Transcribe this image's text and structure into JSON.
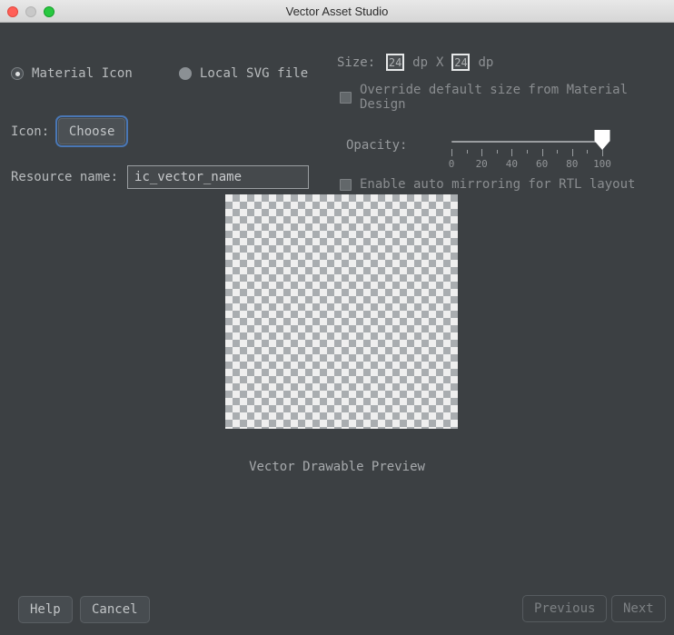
{
  "window": {
    "title": "Vector Asset Studio",
    "traffic_lights": [
      "close-button",
      "minimize-button",
      "zoom-button"
    ]
  },
  "asset_type": {
    "options": [
      {
        "label": "Material Icon",
        "selected": true
      },
      {
        "label": "Local SVG file",
        "selected": false
      }
    ]
  },
  "icon": {
    "label": "Icon:",
    "choose_label": "Choose"
  },
  "resource": {
    "label": "Resource name:",
    "value": "ic_vector_name",
    "placeholder": "ic_vector_name"
  },
  "size": {
    "label": "Size:",
    "width": "24",
    "height": "24",
    "unit": "dp",
    "separator": "X",
    "override_label": "Override default size from Material Design",
    "override_checked": false
  },
  "opacity": {
    "label": "Opacity:",
    "value": 100,
    "min": 0,
    "max": 100,
    "major_ticks": [
      0,
      20,
      40,
      60,
      80,
      100
    ],
    "minor_ticks": [
      10,
      30,
      50,
      70,
      90
    ],
    "tick_labels": [
      "0",
      "20",
      "40",
      "60",
      "80",
      "100"
    ]
  },
  "rtl": {
    "label": "Enable auto mirroring for RTL layout",
    "checked": false
  },
  "preview": {
    "caption": "Vector Drawable Preview"
  },
  "footer": {
    "help_label": "Help",
    "cancel_label": "Cancel",
    "previous_label": "Previous",
    "next_label": "Next"
  },
  "colors": {
    "background": "#3c4043",
    "accent_focus": "#4a77b5",
    "text_primary": "#b9bcbe",
    "text_muted": "#8a8d90",
    "checker_light": "#efefef",
    "checker_dark": "#a9adb0"
  }
}
